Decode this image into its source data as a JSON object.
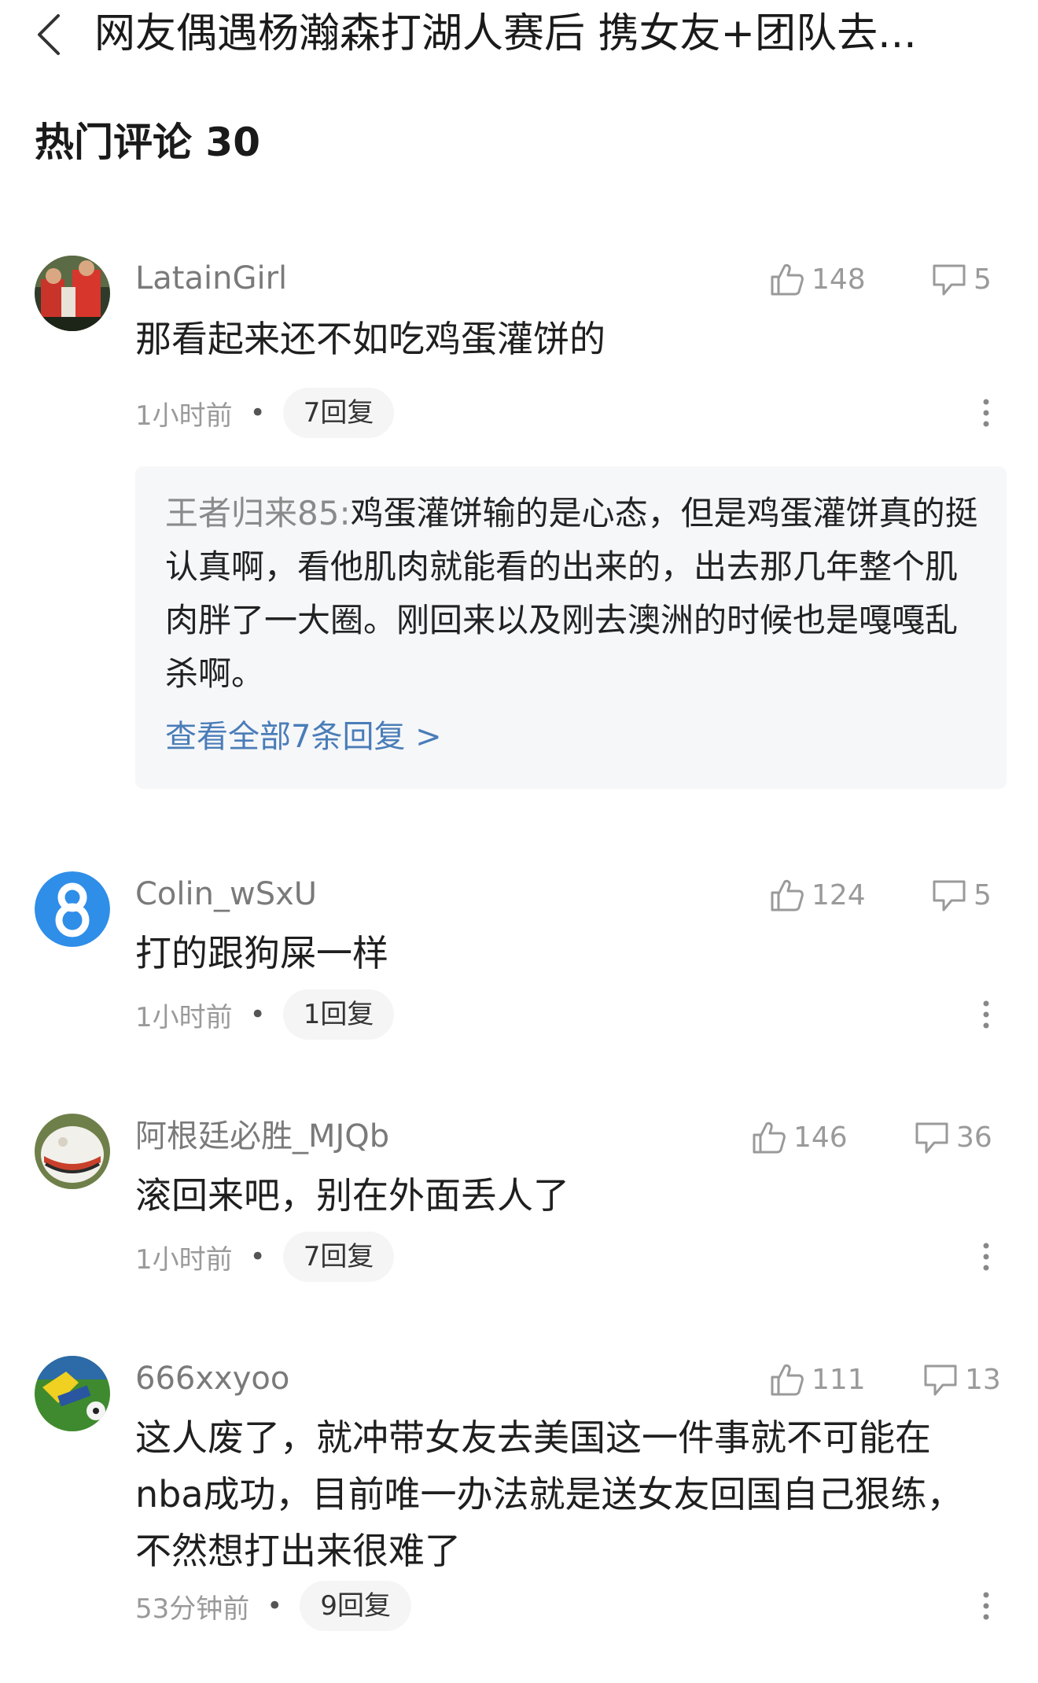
{
  "header": {
    "title": "网友偶遇杨瀚森打湖人赛后 携女友+团队去..."
  },
  "section": {
    "title": "热门评论 30"
  },
  "comments": [
    {
      "username": "LatainGirl",
      "likes": "148",
      "replies_count": "5",
      "text": "那看起来还不如吃鸡蛋灌饼的",
      "time": "1小时前",
      "reply_label": "7回复",
      "reply_preview": {
        "author": "王者归来85:",
        "text": "鸡蛋灌饼输的是心态，但是鸡蛋灌饼真的挺认真啊，看他肌肉就能看的出来的，出去那几年整个肌肉胖了一大圈。刚回来以及刚去澳洲的时候也是嘎嘎乱杀啊。",
        "view_all": "查看全部7条回复 >"
      }
    },
    {
      "username": "Colin_wSxU",
      "likes": "124",
      "replies_count": "5",
      "text": "打的跟狗屎一样",
      "time": "1小时前",
      "reply_label": "1回复"
    },
    {
      "username": "阿根廷必胜_MJQb",
      "likes": "146",
      "replies_count": "36",
      "text": "滚回来吧，别在外面丢人了",
      "time": "1小时前",
      "reply_label": "7回复"
    },
    {
      "username": "666xxyoo",
      "likes": "111",
      "replies_count": "13",
      "text": "这人废了，就冲带女友去美国这一件事就不可能在nba成功，目前唯一办法就是送女友回国自己狠练，不然想打出来很难了",
      "time": "53分钟前",
      "reply_label": "9回复"
    }
  ],
  "colors": {
    "link": "#4a7db8",
    "meta": "#9a9a9a",
    "reply_bg": "#f6f7f9"
  }
}
